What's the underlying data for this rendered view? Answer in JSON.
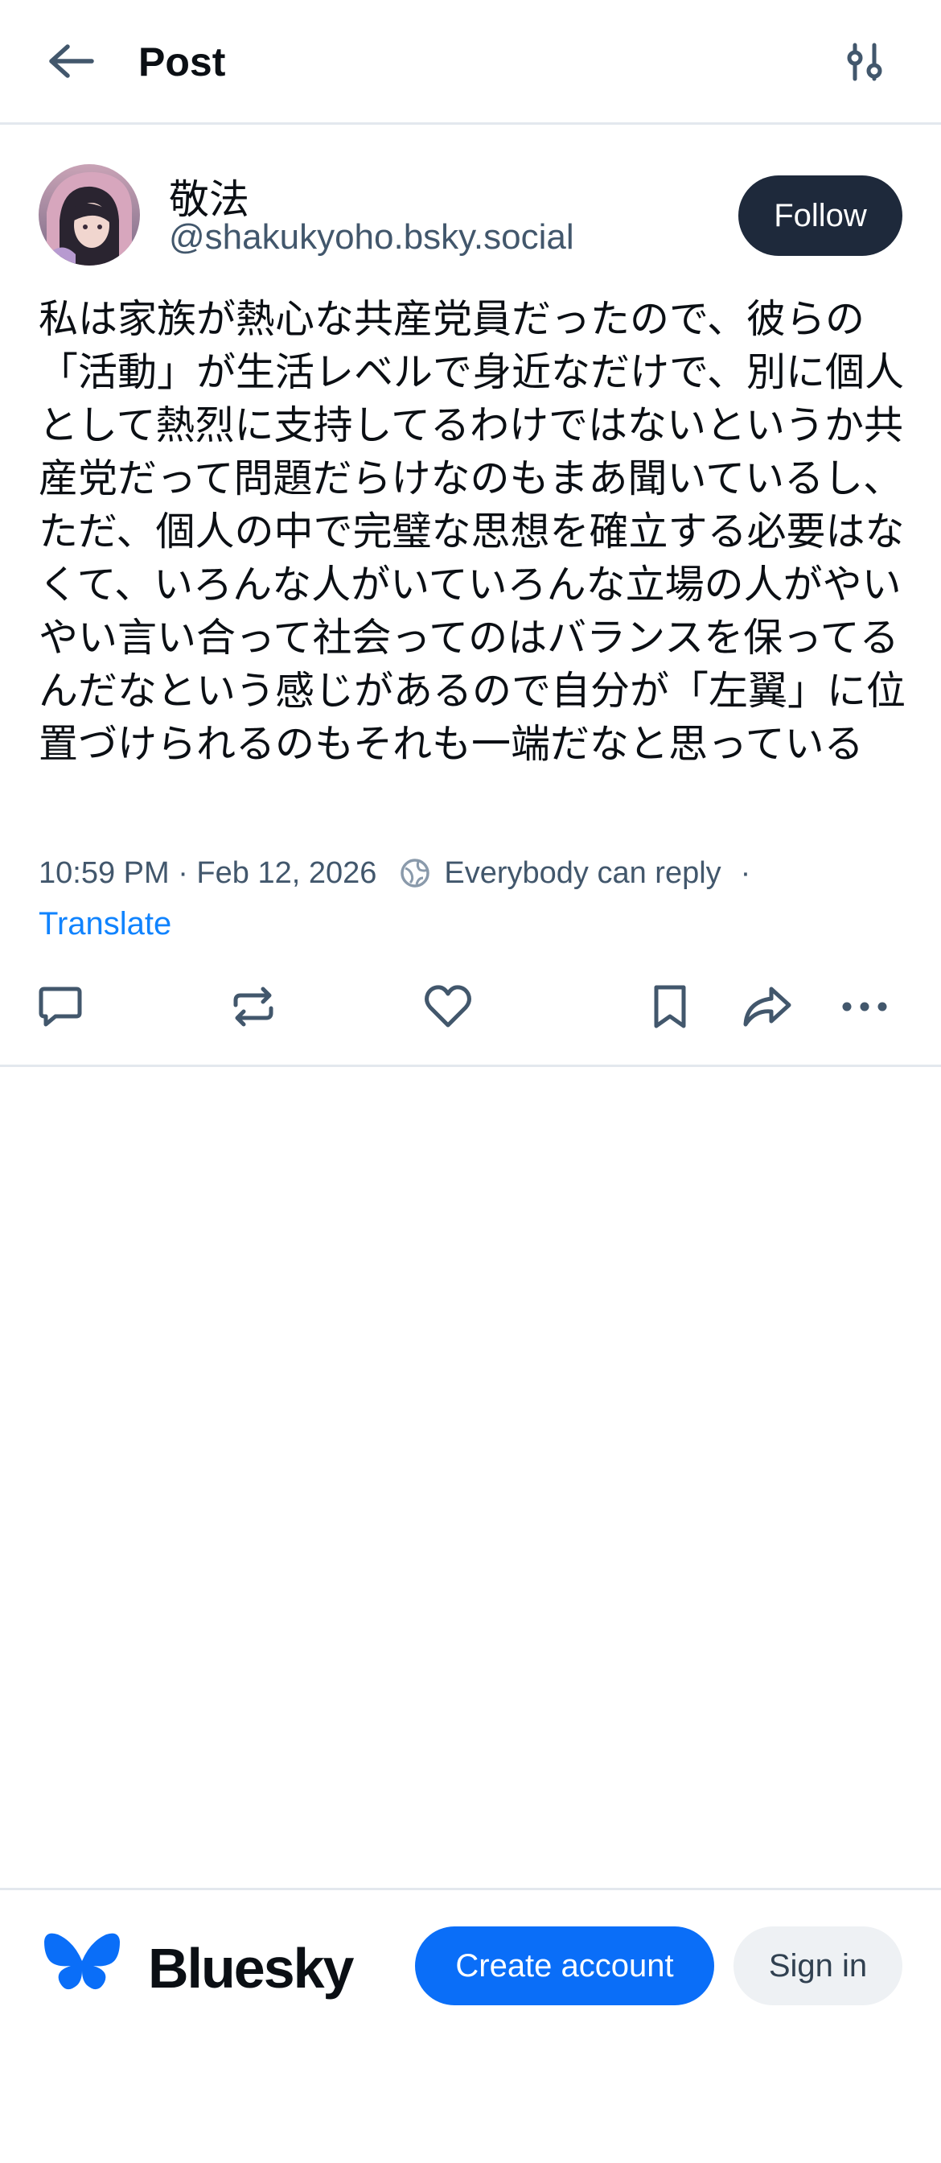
{
  "header": {
    "title": "Post",
    "back_icon": "arrow-left-icon",
    "filter_icon": "sliders-icon"
  },
  "post": {
    "author": {
      "display_name": "敬法",
      "handle": "@shakukyoho.bsky.social",
      "follow_label": "Follow"
    },
    "text": "私は家族が熱心な共産党員だったので、彼らの「活動」が生活レベルで身近なだけで、別に個人として熱烈に支持してるわけではないというか共産党だって問題だらけなのもまあ聞いているし、ただ、個人の中で完璧な思想を確立する必要はなくて、いろんな人がいていろんな立場の人がやいやい言い合って社会ってのはバランスを保ってるんだなという感じがあるので自分が「左翼」に位置づけられるのもそれも一端だなと思っている",
    "timestamp": "10:59 PM · Feb 12, 2026",
    "reply_setting": "Everybody can reply",
    "separator": "·",
    "translate_label": "Translate",
    "actions": [
      "reply-icon",
      "repost-icon",
      "like-icon",
      "bookmark-icon",
      "share-icon",
      "more-icon"
    ]
  },
  "footer": {
    "brand": "Bluesky",
    "create_account_label": "Create account",
    "sign_in_label": "Sign in"
  },
  "colors": {
    "brand_blue": "#0a6ef8",
    "follow_bg": "#1e293b",
    "muted_text": "#42576c",
    "link": "#1083fe"
  }
}
